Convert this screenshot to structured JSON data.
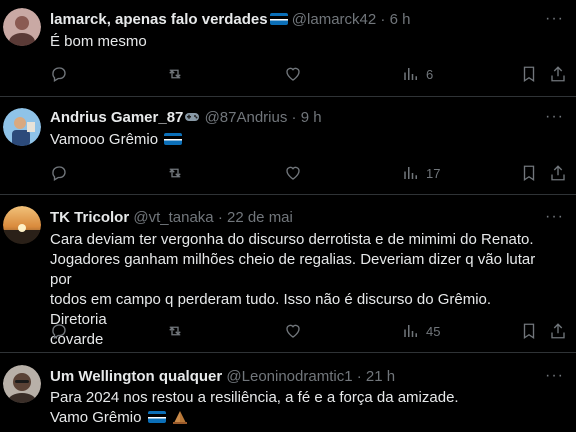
{
  "tweets": [
    {
      "display_name": "lamarck, apenas falo verdades",
      "handle": "@lamarck42",
      "time": "6 h",
      "text_lines": [
        "É bom mesmo"
      ],
      "views": "6",
      "avatar_colors": [
        "#c9a9a4",
        "#5a3a36"
      ],
      "emoji": "estonia-flag-icon"
    },
    {
      "display_name": "Andrius Gamer_87",
      "handle": "@87Andrius",
      "time": "9 h",
      "text_lines": [
        "Vamooo Grêmio"
      ],
      "views": "17",
      "avatar_colors": [
        "#8fc3e8",
        "#2c4a7a"
      ],
      "emoji": "gamepad-icon"
    },
    {
      "display_name": "TK Tricolor",
      "handle": "@vt_tanaka",
      "time": "22 de mai",
      "text_lines": [
        "Cara deviam ter vergonha do discurso derrotista e de mimimi do Renato.",
        "Jogadores ganham milhões cheio de regalias. Deveriam dizer q vão lutar por",
        "todos em campo q perderam tudo. Isso não é discurso do Grêmio. Diretoria",
        "covarde"
      ],
      "views": "45",
      "avatar_colors": [
        "#e0a55a",
        "#3a2a1a"
      ]
    },
    {
      "display_name": "Um Wellington qualquer",
      "handle": "@Leoninodramtic1",
      "time": "21 h",
      "text_lines": [
        "Para 2024 nos restou a resiliência, a fé e a força da amizade.",
        "Vamo Grêmio"
      ],
      "avatar_colors": [
        "#b8b0a8",
        "#3a2e28"
      ]
    }
  ],
  "separator": "·",
  "colors": {
    "background": "#000000",
    "text": "#e7e9ea",
    "muted": "#71767b",
    "divider": "#2f3336"
  }
}
